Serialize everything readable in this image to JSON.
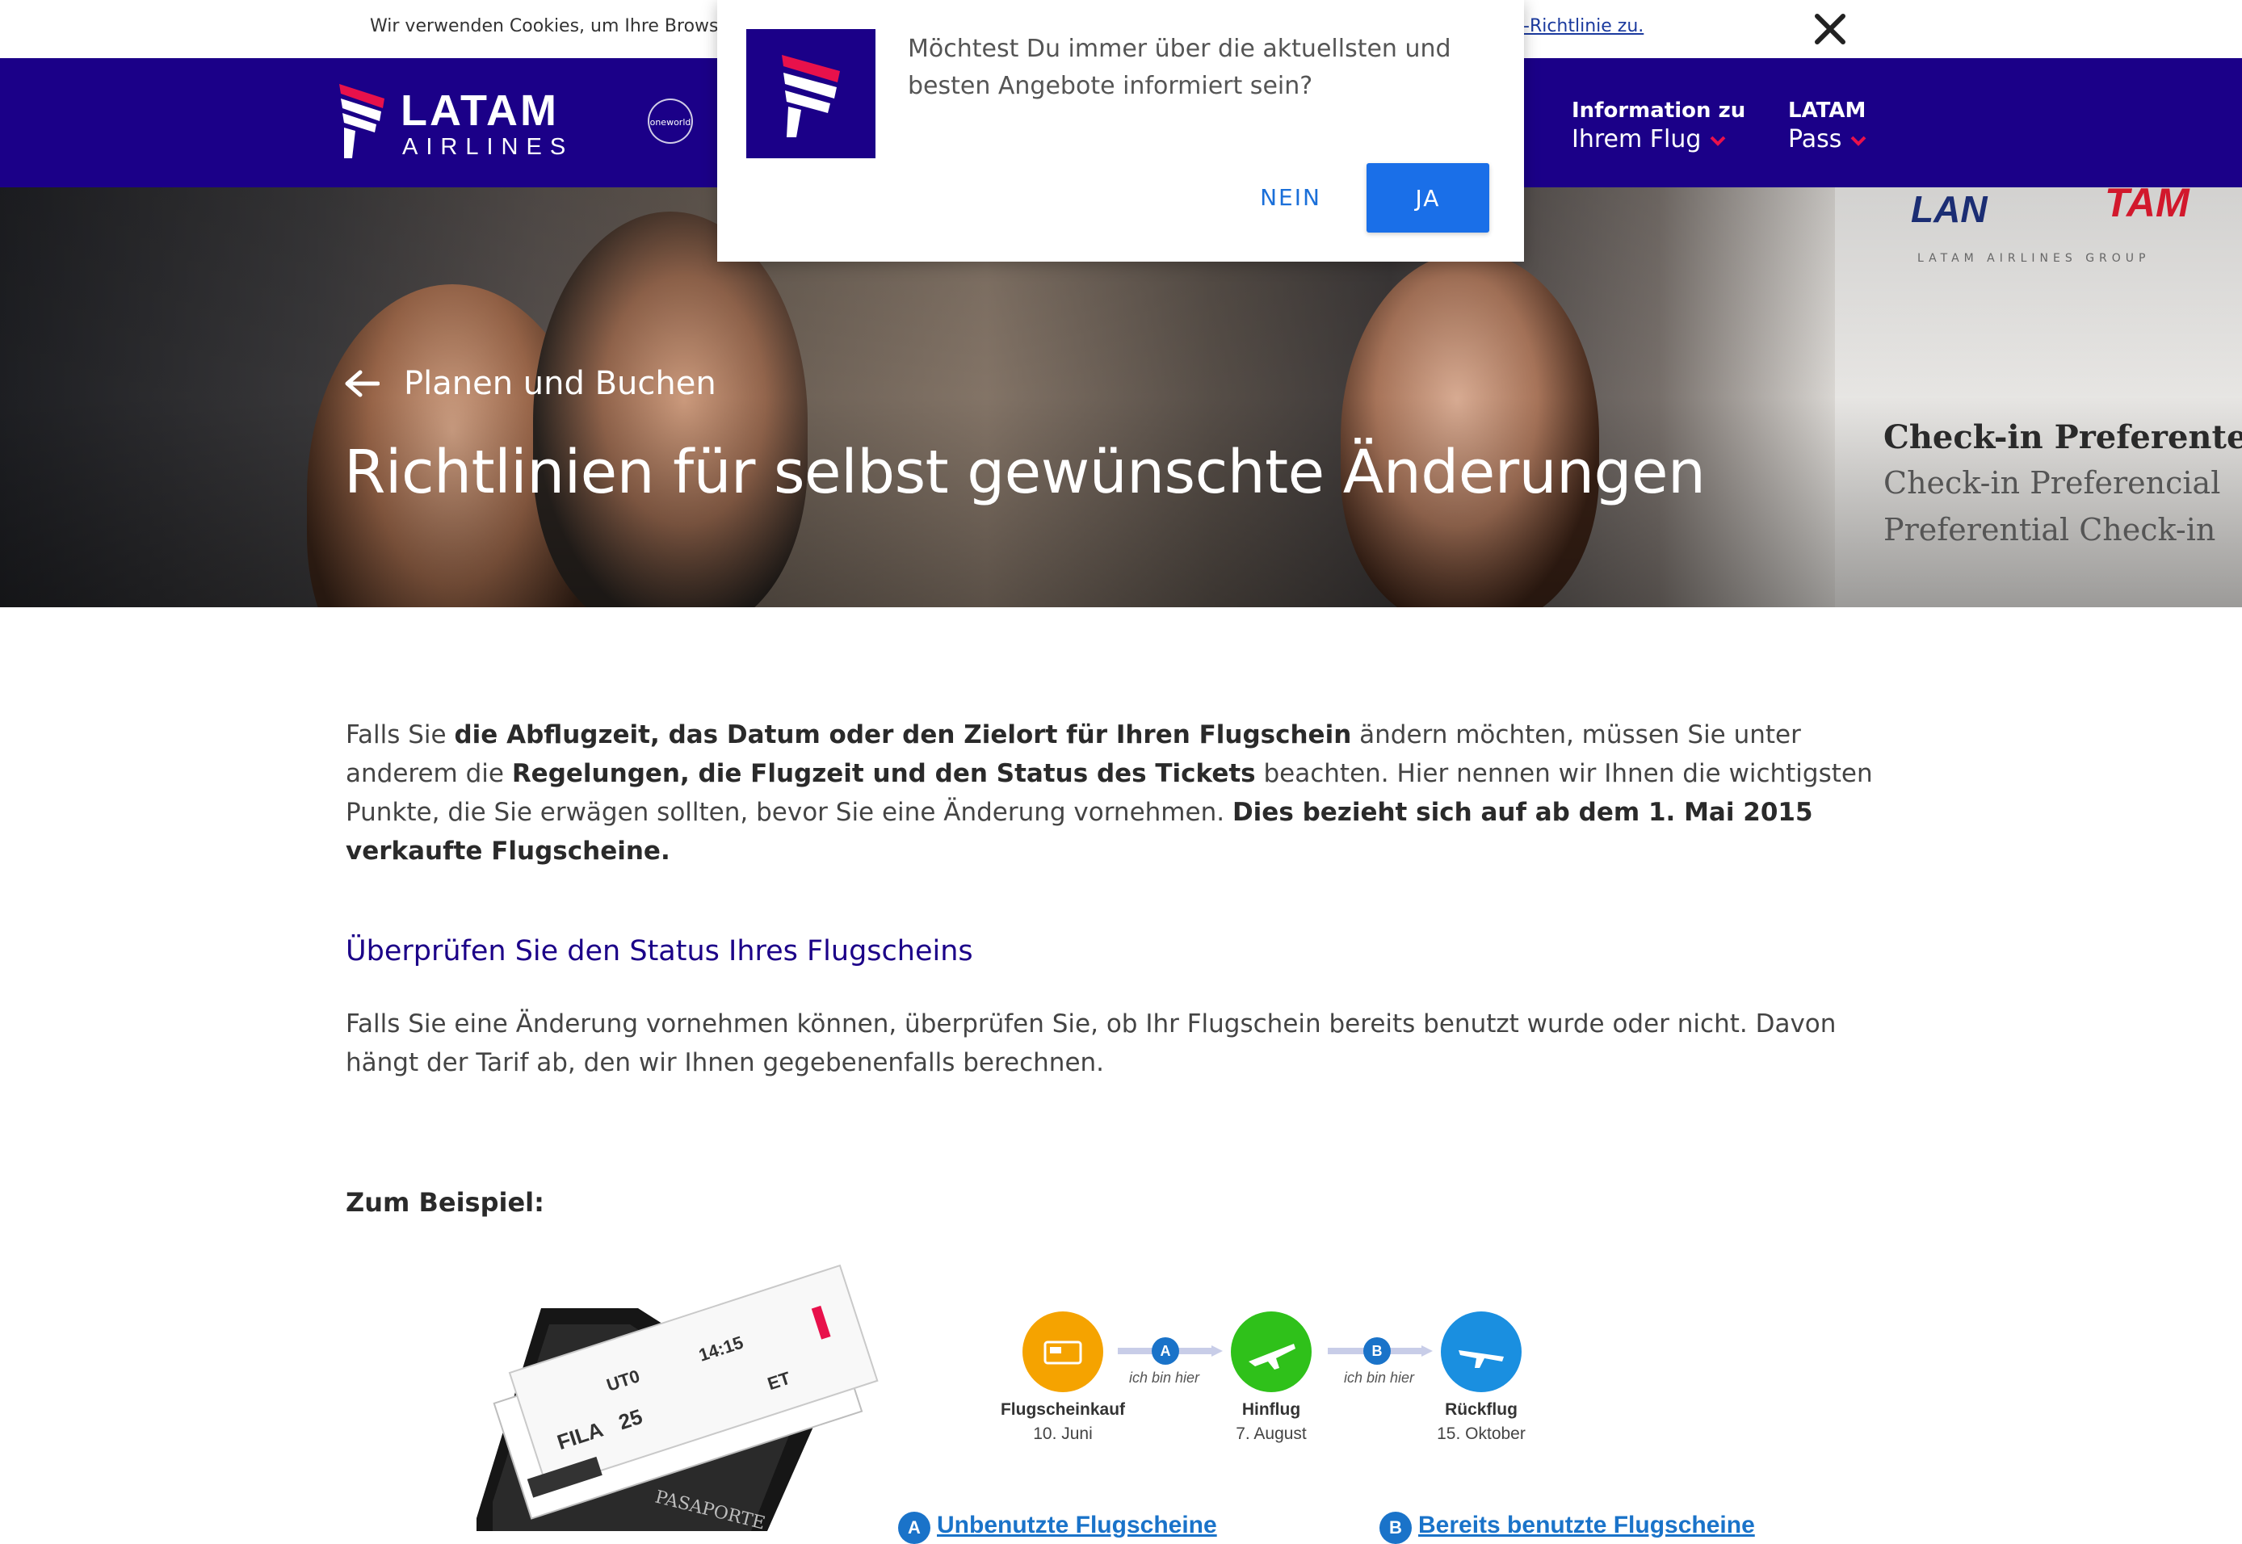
{
  "cookie_bar": {
    "text": "Wir verwenden Cookies, um Ihre Browser-",
    "link_text": "-Richtlinie zu."
  },
  "nav": {
    "logo_latam": "LATAM",
    "logo_airlines": "AIRLINES",
    "oneworld": "oneworld",
    "items": [
      {
        "line1": "Information zu",
        "line2": "Ihrem Flug"
      },
      {
        "line1": "LATAM",
        "line2": "Pass"
      }
    ]
  },
  "popup": {
    "message": "Möchtest Du immer über die aktuellsten und besten Angebote informiert sein?",
    "no_label": "NEIN",
    "yes_label": "JA"
  },
  "hero": {
    "breadcrumb": "Planen und Buchen",
    "title": "Richtlinien für selbst gewünschte Änderungen",
    "sign_lan": "LAN",
    "sign_tam": "TAM",
    "sign_group": "LATAM AIRLINES GROUP",
    "sign_lines": [
      "Check-in Preferente",
      "Check-in Preferencial",
      "Preferential Check-in"
    ]
  },
  "intro": {
    "p1": "Falls Sie ",
    "b1": "die Abflugzeit, das Datum oder den Zielort für Ihren Flugschein",
    "p2": " ändern möchten, müssen Sie unter anderem die ",
    "b2": "Regelungen, die Flugzeit und den Status des Tickets",
    "p3": " beachten. Hier nennen wir Ihnen die wichtigsten Punkte, die Sie erwägen sollten, bevor Sie eine Änderung vornehmen. ",
    "b3": "Dies bezieht sich auf ab dem 1. Mai 2015 verkaufte Flugscheine."
  },
  "section": {
    "heading": "Überprüfen Sie den Status Ihres Flugscheins",
    "paragraph": "Falls Sie eine Änderung vornehmen können, überprüfen Sie, ob Ihr Flugschein bereits benutzt wurde oder nicht. Davon hängt der Tarif ab, den wir Ihnen gegebenenfalls berechnen."
  },
  "example": {
    "label": "Zum Beispiel:",
    "steps": [
      {
        "label": "Flugscheinkauf",
        "date": "10. Juni",
        "color": "#f5a300"
      },
      {
        "label": "Hinflug",
        "date": "7. August",
        "color": "#2fc11a"
      },
      {
        "label": "Rückflug",
        "date": "15. Oktober",
        "color": "#1a8fe0"
      }
    ],
    "connectors": [
      {
        "badge": "A",
        "note": "ich bin hier"
      },
      {
        "badge": "B",
        "note": "ich bin hier"
      }
    ],
    "legend": [
      {
        "badge": "A",
        "text": "Unbenutzte Flugscheine"
      },
      {
        "badge": "B",
        "text": "Bereits benutzte Flugscheine"
      }
    ],
    "ticket_texts": [
      "FILA",
      "25",
      "UT0",
      "14:15",
      "ET",
      "PASAPORTE"
    ]
  },
  "colors": {
    "brand_navy": "#1b0088",
    "accent_red": "#e8114b",
    "button_blue": "#1a6fe8"
  }
}
